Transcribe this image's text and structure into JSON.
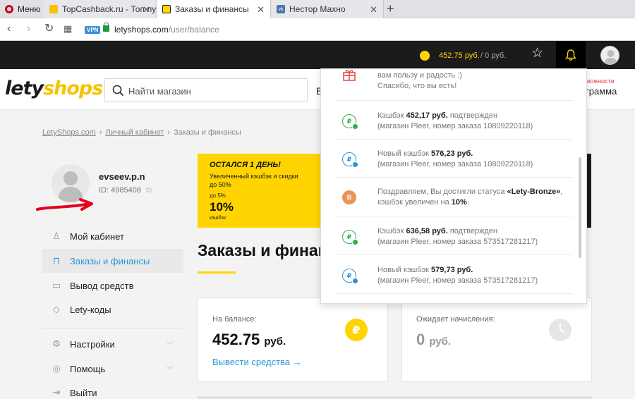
{
  "browser": {
    "menu_label": "Меню",
    "tabs": [
      {
        "title": "TopCashback.ru - Топ луч"
      },
      {
        "title": "Заказы и финансы"
      },
      {
        "title": "Нестор Махно"
      }
    ],
    "new_tab": "+",
    "vpn_label": "VPN",
    "url_host": "letyshops.com",
    "url_path": "/user/balance"
  },
  "topbar": {
    "balance": "452.75 руб.",
    "pending": "/ 0 руб."
  },
  "header": {
    "logo_part1": "lety",
    "logo_part2": "shops",
    "search_placeholder": "Найти магазин",
    "partial_left": "В",
    "partial_right_top": "можности",
    "partial_right_bottom": "грамма"
  },
  "breadcrumb": {
    "items": [
      "LetyShops.com",
      "Личный кабинет"
    ],
    "current": "Заказы и финансы",
    "separator": "›"
  },
  "user": {
    "name": "evseev.p.n",
    "id_label": "ID: 4985408"
  },
  "sidebar": {
    "items": [
      {
        "label": "Мой кабинет"
      },
      {
        "label": "Заказы и финансы"
      },
      {
        "label": "Вывод средств"
      },
      {
        "label": "Lety-коды"
      },
      {
        "label": "Настройки"
      },
      {
        "label": "Помощь"
      },
      {
        "label": "Выйти"
      }
    ]
  },
  "promo": {
    "headline": "ОСТАЛСЯ 1 ДЕНЬ!",
    "subtitle": "Увеличенный кэшбэк и скидки до 50%",
    "up_to": "до 5%",
    "percent": "10%",
    "caption": "кэшбэк"
  },
  "main": {
    "title": "Заказы и финансы"
  },
  "cards": {
    "balance": {
      "label": "На балансе:",
      "amount": "452.75",
      "currency": "руб.",
      "link": "Вывести средства →"
    },
    "pending": {
      "label": "Ожидает начисления:",
      "amount": "0",
      "currency": "руб."
    }
  },
  "notifications": [
    {
      "type": "gift",
      "pre": "вам пользу и радость :)",
      "line2": "Спасибо, что вы есть!"
    },
    {
      "type": "confirmed",
      "pre": "Кэшбэк ",
      "amount": "452,17 руб.",
      "post": " подтвержден",
      "detail": "(магазин Pleer, номер заказа 10809220118)"
    },
    {
      "type": "new",
      "pre": "Новый кэшбэк ",
      "amount": "576,23 руб.",
      "post": "",
      "detail": "(магазин Pleer, номер заказа 10809220118)"
    },
    {
      "type": "status",
      "pre": "Поздравляем, Вы достигли статуса ",
      "status": "«Lety-Bronze»",
      "post": ",",
      "line2_pre": "кэшбэк увеличен на ",
      "line2_bold": "10%",
      "line2_post": "."
    },
    {
      "type": "confirmed",
      "pre": "Кэшбэк ",
      "amount": "636,58 руб.",
      "post": " подтвержден",
      "detail": "(магазин Pleer, номер заказа 573517281217)"
    },
    {
      "type": "new",
      "pre": "Новый кэшбэк ",
      "amount": "579,73 руб.",
      "post": "",
      "detail": "(магазин Pleer, номер заказа 573517281217)"
    }
  ],
  "colors": {
    "brand_yellow": "#ffd400",
    "link_blue": "#2a96d8",
    "success_green": "#2eb04b",
    "annotation_red": "#e3001b"
  }
}
